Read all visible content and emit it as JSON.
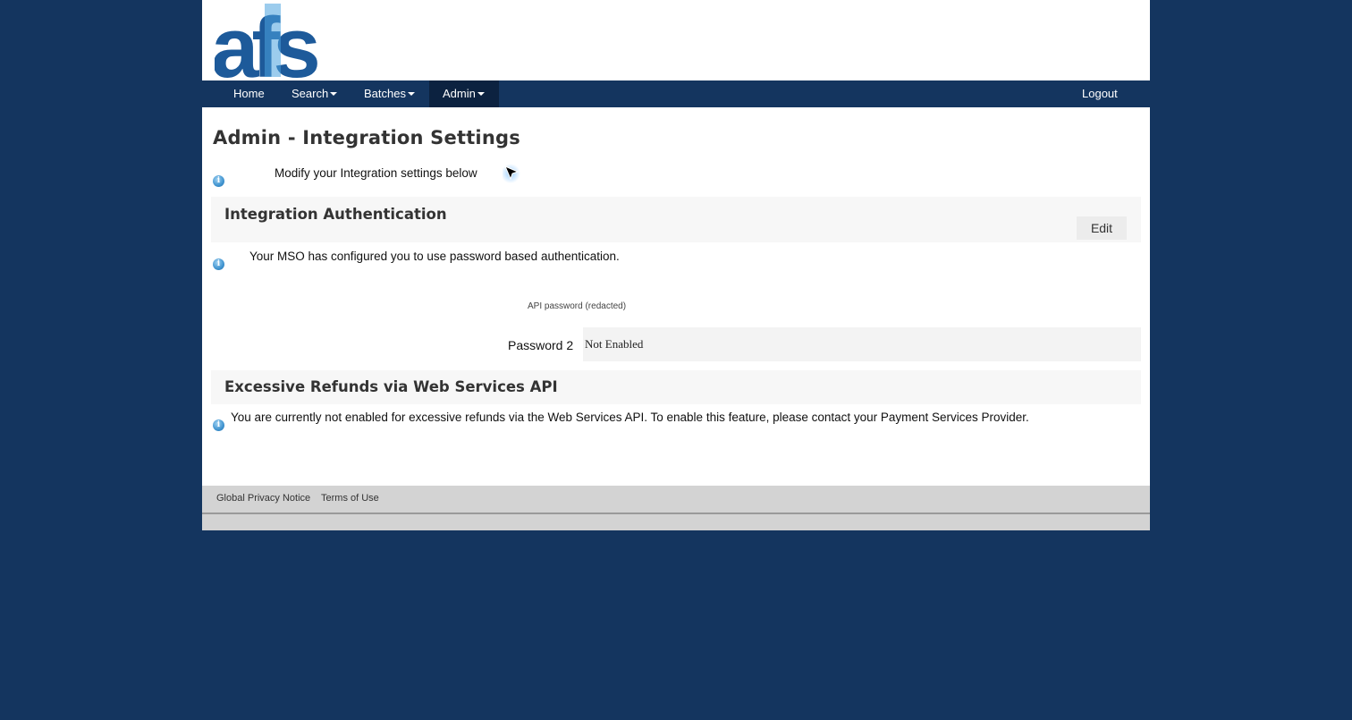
{
  "logo": {
    "text": "afs"
  },
  "nav": {
    "items": [
      {
        "label": "Home"
      },
      {
        "label": "Search"
      },
      {
        "label": "Batches"
      },
      {
        "label": "Admin"
      }
    ],
    "logout": "Logout"
  },
  "page": {
    "title": "Admin - Integration Settings",
    "intro": "Modify your Integration settings below"
  },
  "integration_auth": {
    "title": "Integration Authentication",
    "edit_label": "Edit",
    "message": "Your MSO has configured you to use password based authentication.",
    "api_password_caption": "API password (redacted)",
    "password2_label": "Password 2",
    "password2_value": "Not Enabled"
  },
  "excessive_refunds": {
    "title": "Excessive Refunds via Web Services API",
    "message": "You are currently not enabled for excessive refunds via the Web Services API. To enable this feature, please contact your Payment Services Provider."
  },
  "footer": {
    "links": [
      {
        "label": "Global Privacy Notice"
      },
      {
        "label": "Terms of Use"
      }
    ]
  },
  "colors": {
    "background": "#14355f",
    "nav_active": "#0c2240",
    "logo_dark": "#1d5a9a",
    "logo_light": "#4aa3df"
  },
  "icons": {
    "info": "info-icon",
    "caret": "caret-down-icon",
    "cursor": "mouse-pointer-icon"
  }
}
